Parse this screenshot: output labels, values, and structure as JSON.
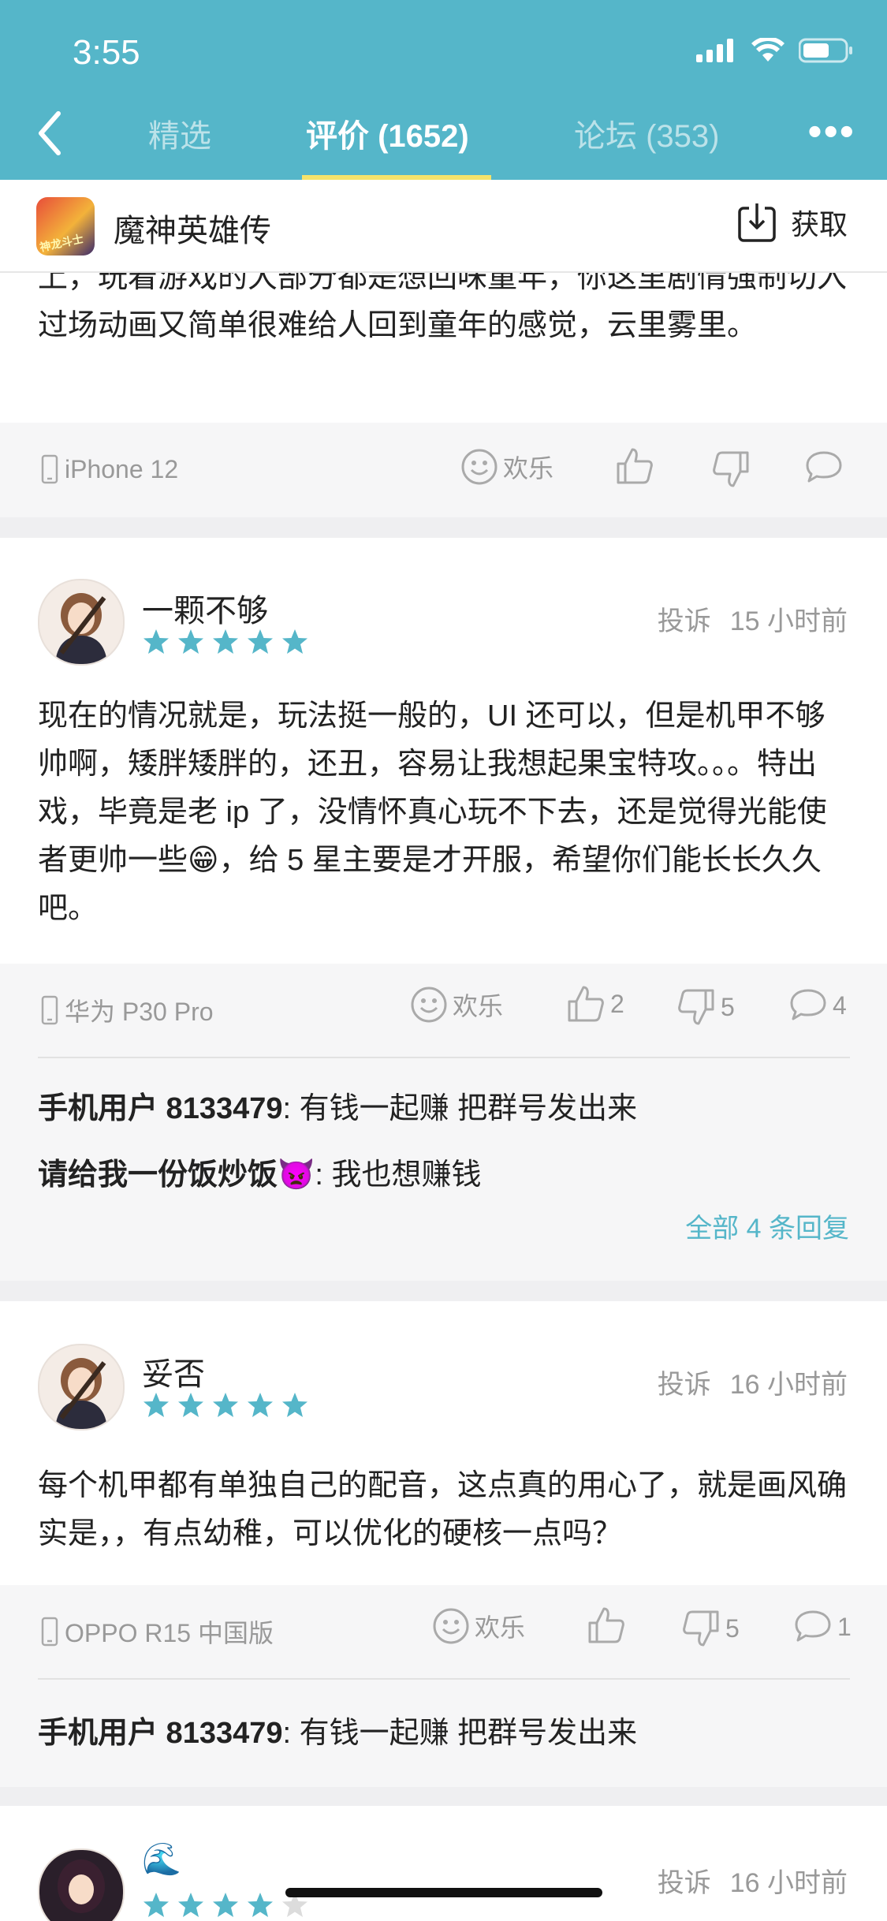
{
  "status_bar": {
    "time": "3:55"
  },
  "nav": {
    "tabs": [
      {
        "label": "精选"
      },
      {
        "label": "评价 (1652)"
      },
      {
        "label": "论坛 (353)"
      }
    ],
    "more_label": "•••"
  },
  "app": {
    "name": "魔神英雄传",
    "get_label": "获取"
  },
  "first_review": {
    "text": "上，玩着游戏的大部分都是想回味童年，你这里剧情强制切入过场动画又简单很难给人回到童年的感觉，云里雾里。",
    "device": "iPhone 12",
    "reaction_label": "欢乐"
  },
  "reviews": [
    {
      "username": "一颗不够",
      "stars": 5,
      "report_label": "投诉",
      "time": "15 小时前",
      "text": "现在的情况就是，玩法挺一般的，UI 还可以，但是机甲不够帅啊，矮胖矮胖的，还丑，容易让我想起果宝特攻。。。特出戏，毕竟是老 ip 了，没情怀真心玩不下去，还是觉得光能使者更帅一些😁，给 5 星主要是才开服，希望你们能长长久久吧。",
      "device": "华为 P30 Pro",
      "reaction_label": "欢乐",
      "likes": "2",
      "dislikes": "5",
      "comments": "4",
      "replies": [
        {
          "user": "手机用户 8133479",
          "text": ": 有钱一起赚 把群号发出来"
        },
        {
          "user": "请给我一份饭炒饭👿",
          "text": ": 我也想赚钱"
        }
      ],
      "all_replies_label": "全部 4 条回复"
    },
    {
      "username": "妥否",
      "stars": 5,
      "report_label": "投诉",
      "time": "16 小时前",
      "text": "每个机甲都有单独自己的配音，这点真的用心了，就是画风确实是，，有点幼稚，可以优化的硬核一点吗？",
      "device": "OPPO R15 中国版",
      "reaction_label": "欢乐",
      "likes": "",
      "dislikes": "5",
      "comments": "1",
      "replies": [
        {
          "user": "手机用户 8133479",
          "text": ": 有钱一起赚 把群号发出来"
        }
      ]
    },
    {
      "username": "🌊",
      "stars": 4,
      "report_label": "投诉",
      "time": "16 小时前"
    }
  ],
  "colors": {
    "accent": "#55b6c9",
    "star": "#55b6c9",
    "indicator": "#f5e36b"
  }
}
